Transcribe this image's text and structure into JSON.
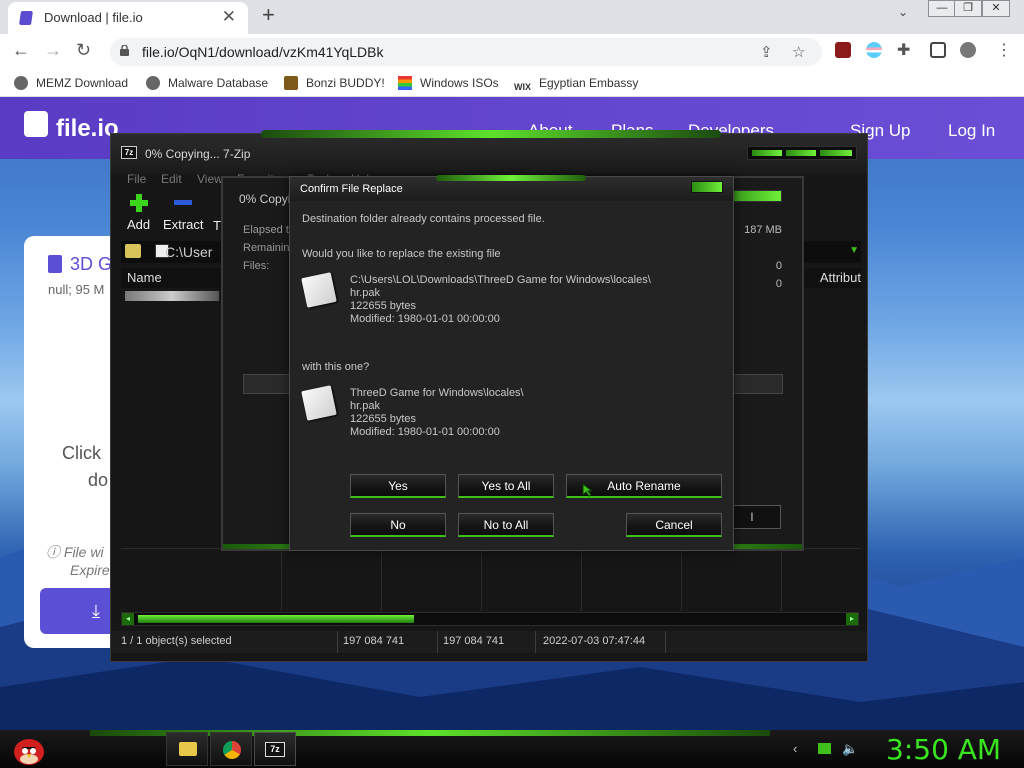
{
  "browser": {
    "tab_title": "Download | file.io",
    "tab_close": "✕",
    "new_tab": "+",
    "tabs_menu": "⌄",
    "window_buttons": [
      "—",
      "❐",
      "✕"
    ],
    "url": "file.io/OqN1/download/vzKm41YqLDBk",
    "bookmarks": [
      "MEMZ Download",
      "Malware Database",
      "Bonzi BUDDY!",
      "Windows ISOs",
      "Egyptian Embassy"
    ]
  },
  "site": {
    "logo": "file.io",
    "nav": [
      "About",
      "Plans",
      "Developers",
      "Sign Up",
      "Log In"
    ],
    "file_title": "3D G",
    "file_meta": "null; 95 M",
    "click_line1": "Click",
    "click_line2": "do",
    "warn_line1": "File wi",
    "warn_line2": "Expire"
  },
  "zip": {
    "icon_text": "7z",
    "title": "0% Copying... 7-Zip",
    "menu": [
      "File",
      "Edit",
      "View",
      "Favorites",
      "Tools",
      "Help"
    ],
    "toolbar": [
      "Add",
      "Extract",
      "T"
    ],
    "path": "C:\\User",
    "columns": [
      "Name",
      "Attribut"
    ],
    "status": [
      "1 / 1 object(s) selected",
      "197 084 741",
      "197 084 741",
      "2022-07-03 07:47:44"
    ]
  },
  "progress": {
    "title": "0% Copyin",
    "labels": [
      "Elapsed ti",
      "Remaining",
      "Files:"
    ],
    "values": [
      "187 MB",
      "0",
      "0"
    ]
  },
  "confirm": {
    "title": "Confirm File Replace",
    "message1": "Destination folder already contains processed file.",
    "message2": "Would you like to replace the existing file",
    "existing": {
      "path": "C:\\Users\\LOL\\Downloads\\ThreeD Game for Windows\\locales\\",
      "name": "hr.pak",
      "size": "122655 bytes",
      "modified": "Modified: 1980-01-01 00:00:00"
    },
    "message3": "with this one?",
    "incoming": {
      "path": "ThreeD Game for Windows\\locales\\",
      "name": "hr.pak",
      "size": "122655 bytes",
      "modified": "Modified: 1980-01-01 00:00:00"
    },
    "buttons": {
      "yes": "Yes",
      "yes_all": "Yes to All",
      "auto_rename": "Auto Rename",
      "no": "No",
      "no_all": "No to All",
      "cancel": "Cancel"
    }
  },
  "taskbar": {
    "zip_icon": "7z",
    "clock": "3:50 AM"
  },
  "colors": {
    "accent_green": "#5de22b",
    "clock_green": "#38e51f",
    "site_purple": "#5b4fd6"
  }
}
